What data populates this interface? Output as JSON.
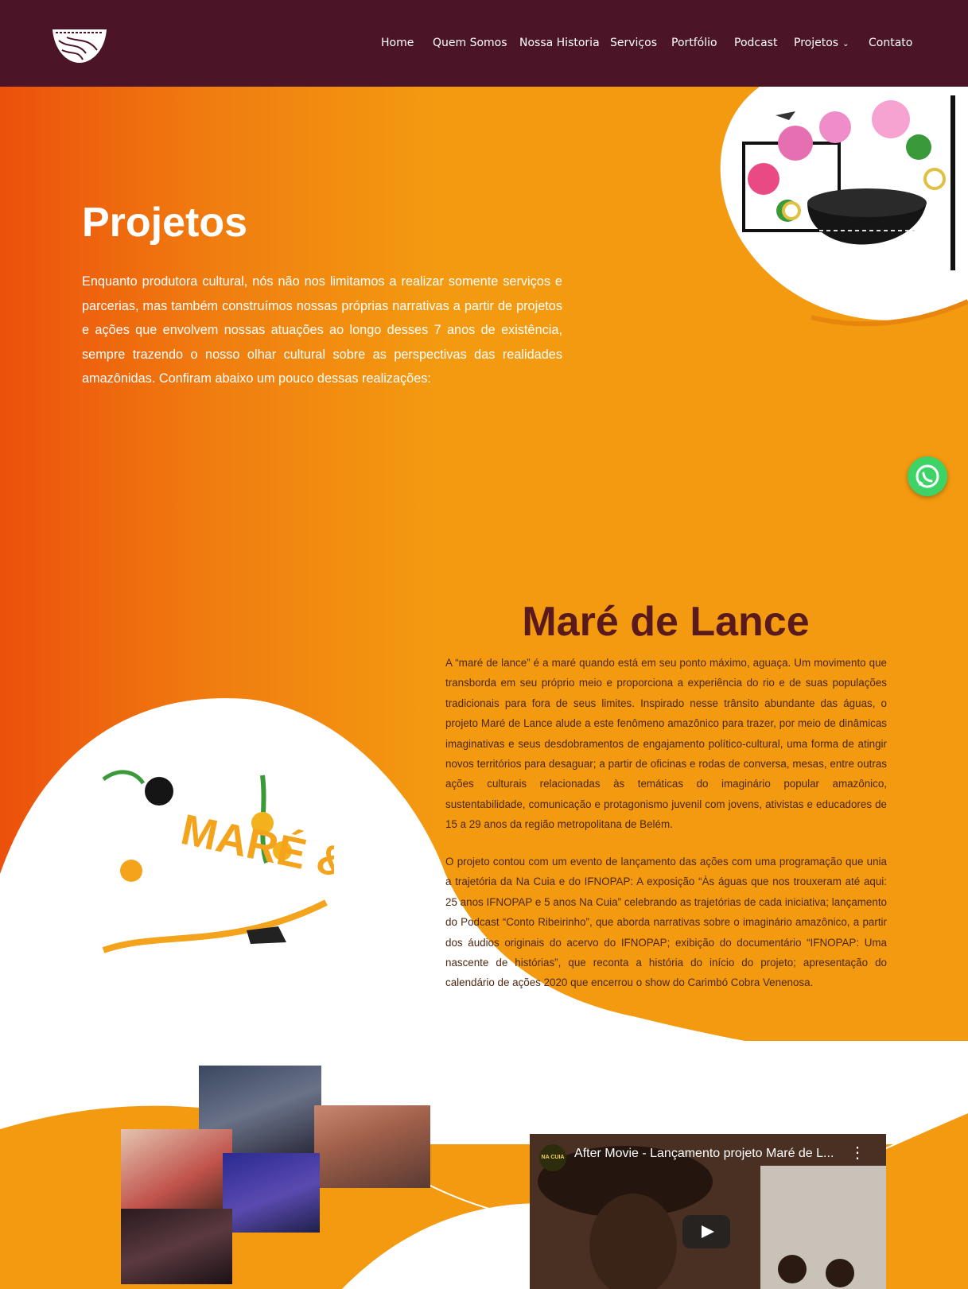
{
  "header": {
    "logo_icon": "bowl-logo",
    "nav": [
      {
        "label": "Home"
      },
      {
        "label": "Quem Somos"
      },
      {
        "label": "Nossa Historia"
      },
      {
        "label": "Serviços"
      },
      {
        "label": "Portfólio"
      },
      {
        "label": "Podcast"
      },
      {
        "label": "Projetos",
        "has_dropdown": true
      },
      {
        "label": "Contato"
      }
    ],
    "background_color": "#4b1427"
  },
  "hero": {
    "title": "Projetos",
    "intro": "Enquanto produtora cultural, nós não nos limitamos a realizar somente serviços e parcerias, mas também construímos nossas próprias narrativas a partir de projetos e ações que envolvem nossas atuações ao longo desses 7 anos de existência, sempre trazendo o nosso olhar cultural sobre as perspectivas das realidades amazônidas. Confiram abaixo um pouco dessas realizações:"
  },
  "project": {
    "title": "Maré de Lance",
    "paragraph_1": "A “maré de lance” é a maré quando está em seu ponto máximo, aguaça. Um movimento que transborda em seu próprio meio e proporciona a experiência do rio e de suas populações tradicionais para fora de seus limites. Inspirado nesse trânsito abundante das águas, o projeto Maré de Lance alude a este fenômeno amazônico para trazer, por meio de dinâmicas imaginativas e seus desdobramentos de engajamento político-cultural, uma forma de atingir novos territórios para desaguar; a partir de oficinas e rodas de conversa, mesas, entre outras ações culturais relacionadas às temáticas do imaginário popular amazônico, sustentabilidade, comunicação e protagonismo juvenil com jovens, ativistas e educadores de 15 a 29 anos da região metropolitana de Belém.",
    "paragraph_2": "O projeto contou com um evento de lançamento das ações com uma programação que unia a trajetória da Na Cuia e do IFNOPAP: A exposição “Às águas que nos trouxeram até aqui: 25 anos IFNOPAP e 5 anos Na Cuia” celebrando as trajetórias de cada iniciativa; lançamento do Podcast “Conto Ribeirinho”, que aborda narrativas sobre o imaginário amazônico, a partir dos áudios originais do acervo do IFNOPAP; exibição do documentário “IFNOPAP: Uma nascente de histórias”, que reconta a história do início do projeto; apresentação do calendário de ações 2020 que encerrou o show do Carimbó Cobra Venenosa.",
    "logo_text": "MARÉ & LANCE"
  },
  "video": {
    "title": "After Movie - Lançamento projeto Maré de L...",
    "channel_badge": "NA CUIA",
    "more_icon": "kebab-menu-icon",
    "play_icon": "play-icon"
  },
  "floating": {
    "whatsapp_icon": "whatsapp-icon"
  },
  "colors": {
    "accent_orange": "#f39a10",
    "deep_orange": "#ee5a0c",
    "title_brown": "#5a1a1c",
    "white_blob": "#ffffff"
  }
}
